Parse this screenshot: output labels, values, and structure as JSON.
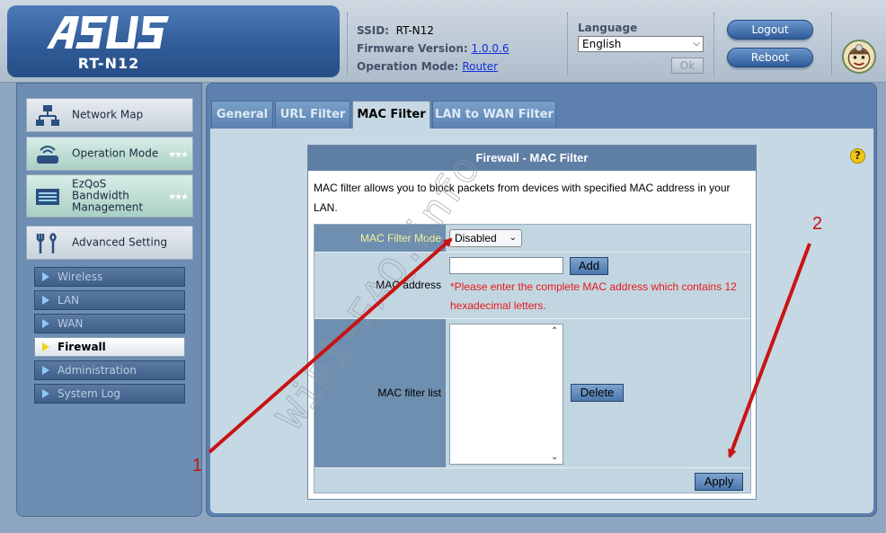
{
  "header": {
    "brand": "ASUS",
    "model": "RT-N12",
    "ssid_label": "SSID:",
    "ssid_value": "RT-N12",
    "firmware_label": "Firmware Version:",
    "firmware_value": "1.0.0.6",
    "mode_label": "Operation Mode:",
    "mode_value": "Router",
    "language_title": "Language",
    "language_selected": "English",
    "ok_label": "Ok",
    "logout_label": "Logout",
    "reboot_label": "Reboot"
  },
  "sidebar": {
    "main_items": [
      {
        "label": "Network Map",
        "icon": "network-map-icon"
      },
      {
        "label": "Operation Mode",
        "icon": "router-icon"
      },
      {
        "label": "EzQoS\nBandwidth\nManagement",
        "icon": "bandwidth-icon"
      },
      {
        "label": "Advanced Setting",
        "icon": "wrench-icon"
      }
    ],
    "sub_items": [
      {
        "label": "Wireless",
        "active": false
      },
      {
        "label": "LAN",
        "active": false
      },
      {
        "label": "WAN",
        "active": false
      },
      {
        "label": "Firewall",
        "active": true
      },
      {
        "label": "Administration",
        "active": false
      },
      {
        "label": "System Log",
        "active": false
      }
    ]
  },
  "tabs": [
    {
      "label": "General",
      "active": false
    },
    {
      "label": "URL Filter",
      "active": false
    },
    {
      "label": "MAC Filter",
      "active": true
    },
    {
      "label": "LAN to WAN Filter",
      "active": false
    }
  ],
  "firewall": {
    "title": "Firewall - MAC Filter",
    "description": "MAC filter allows you to block packets from devices with specified MAC address in your LAN.",
    "mode_label": "MAC Filter Mode",
    "mode_value": "Disabled",
    "mac_label": "MAC address",
    "mac_value": "",
    "add_label": "Add",
    "warning": "*Please enter the complete MAC address which contains 12 hexadecimal letters.",
    "list_label": "MAC filter list",
    "delete_label": "Delete",
    "apply_label": "Apply"
  },
  "annotations": {
    "marker_1": "1",
    "marker_2": "2",
    "watermark": "WiFi-FAQ.info",
    "arrow_color": "#c81414"
  },
  "colors": {
    "accent": "#5f7ea4",
    "warning": "#e8191a",
    "mode_label": "#f6f39a"
  }
}
